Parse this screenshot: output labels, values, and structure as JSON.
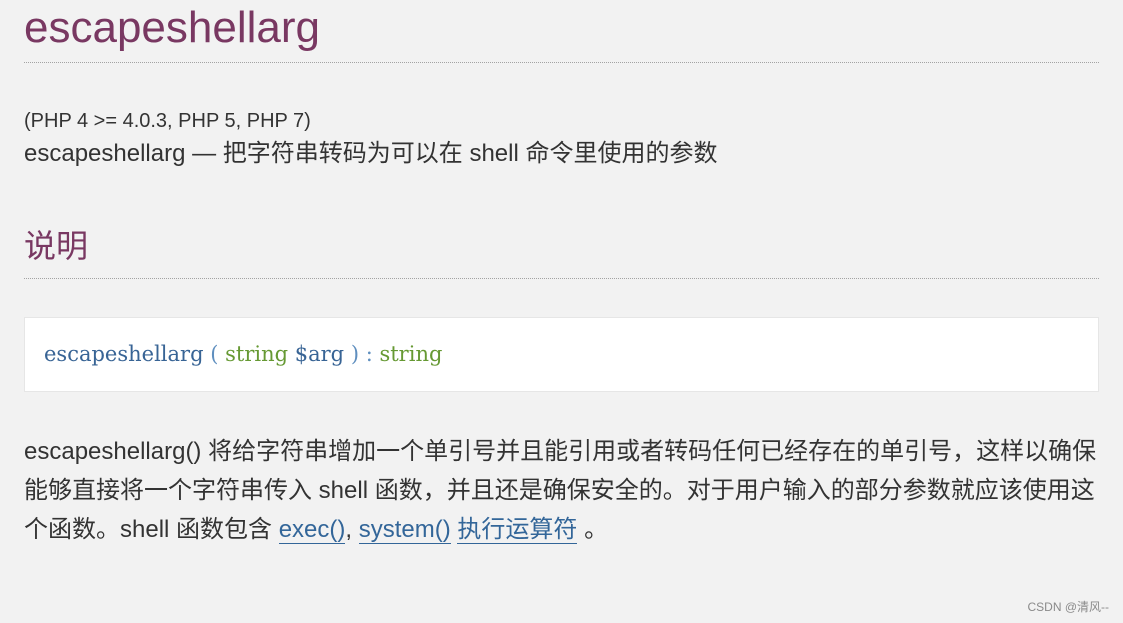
{
  "title": "escapeshellarg",
  "versions": "(PHP 4 >= 4.0.3, PHP 5, PHP 7)",
  "refpurpose": "escapeshellarg — 把字符串转码为可以在 shell 命令里使用的参数",
  "section_title": "说明",
  "synopsis": {
    "function_name": "escapeshellarg",
    "open_paren": "(",
    "param_type": "string",
    "param_name": "$arg",
    "close_paren": ")",
    "colon": ":",
    "return_type": "string"
  },
  "description": {
    "text": "escapeshellarg() 将给字符串增加一个单引号并且能引用或者转码任何已经存在的单引号，这样以确保能够直接将一个字符串传入 shell 函数，并且还是确保安全的。对于用户输入的部分参数就应该使用这个函数。shell 函数包含 ",
    "link_exec": "exec()",
    "sep1": ", ",
    "link_system": "system()",
    "sep2": " ",
    "link_operators": "执行运算符",
    "end": " 。"
  },
  "watermark": "CSDN @清风--"
}
